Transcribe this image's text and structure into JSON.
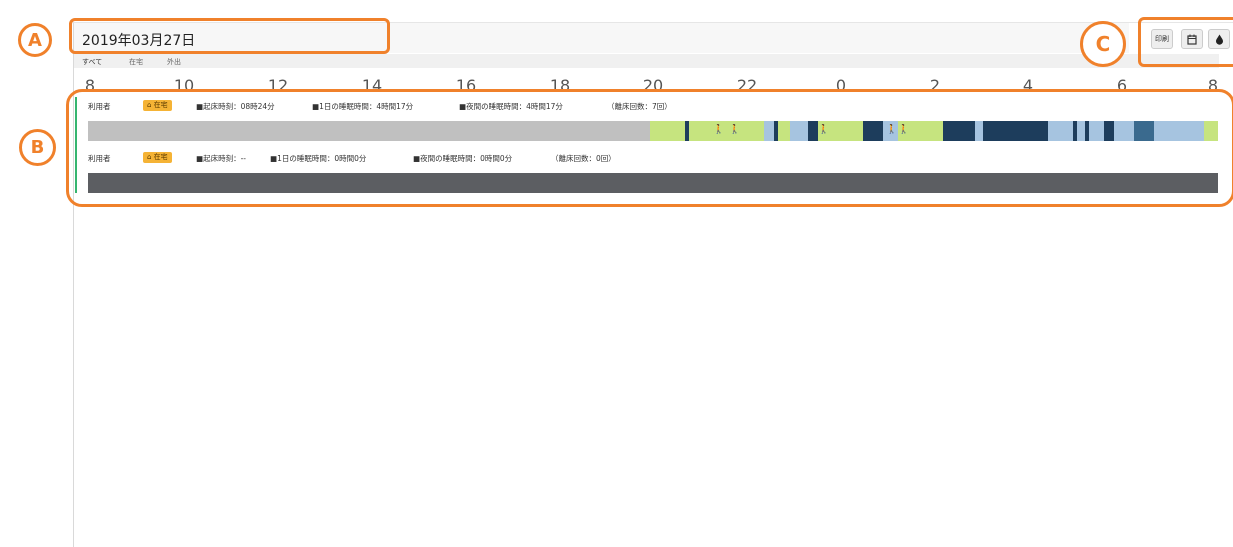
{
  "date": {
    "label": "2019年03月27日"
  },
  "tabs": [
    {
      "label": "すべて",
      "active": true
    },
    {
      "label": "在宅",
      "active": false
    },
    {
      "label": "外出",
      "active": false
    }
  ],
  "axis": {
    "ticks": [
      "8",
      "10",
      "12",
      "14",
      "16",
      "18",
      "20",
      "22",
      "0",
      "2",
      "4",
      "6",
      "8"
    ]
  },
  "toolbar": {
    "print_label": "印刷",
    "calendar_icon": "calendar-icon",
    "drop_icon": "drop-icon"
  },
  "rows": [
    {
      "user": "利用者",
      "status": "在宅",
      "wake": "■起床時刻：08時24分",
      "day_sleep": "■1日の睡眠時間：4時間17分",
      "night_sleep": "■夜間の睡眠時間：4時間17分",
      "exits": "（離床回数：7回）"
    },
    {
      "user": "利用者",
      "status": "在宅",
      "wake": "■起床時刻：--",
      "day_sleep": "■1日の睡眠時間：0時間0分",
      "night_sleep": "■夜間の睡眠時間：0時間0分",
      "exits": "（離床回数：0回）"
    }
  ],
  "callouts": {
    "a": "A",
    "b": "B",
    "c": "C"
  },
  "colors": {
    "no_data": "#c0c0c0",
    "awake": "#c6e47f",
    "light_sleep": "#a6c4e0",
    "deep_sleep": "#1d3d5c",
    "out_of_bed": "#e8322d",
    "callout": "#f0812b"
  }
}
